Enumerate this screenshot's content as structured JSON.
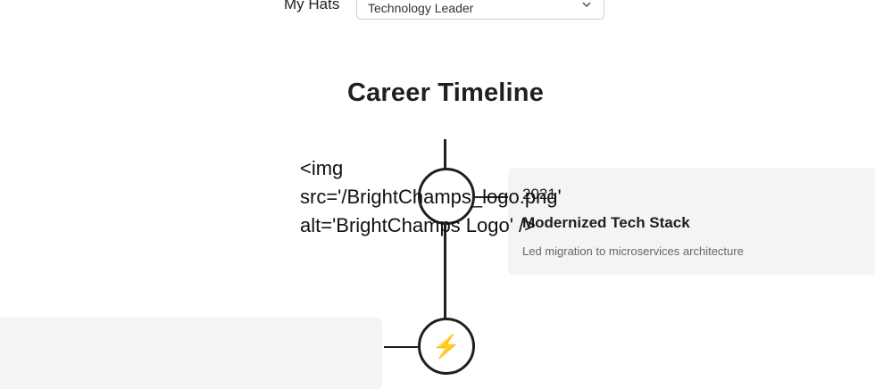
{
  "hats": {
    "label": "My Hats",
    "selected": "Technology Leader"
  },
  "timeline": {
    "title": "Career Timeline",
    "entries": [
      {
        "year": "2021",
        "title": "Modernized Tech Stack",
        "description": "Led migration to microservices architecture",
        "logo_fallback_text": "<img\nsrc='/BrightChamps_logo.png'\nalt='BrightChamps Logo' />"
      },
      {
        "icon": "lightning-icon",
        "icon_glyph": "⚡",
        "icon_color": "#e0b400"
      }
    ]
  }
}
